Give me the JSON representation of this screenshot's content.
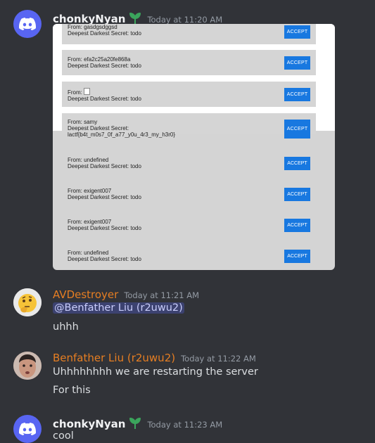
{
  "messages": [
    {
      "username": "chonkyNyan",
      "timestamp": "Today at 11:20 AM",
      "embed": {
        "accept_label": "ACCEPT",
        "rows": [
          {
            "from": "From: gasdgsdggsd",
            "secret": "Deepest Darkest Secret: todo"
          },
          {
            "from": "From: efa2c25a20fe868a",
            "secret": "Deepest Darkest Secret: todo"
          },
          {
            "from": "From:",
            "secret": "Deepest Darkest Secret: todo"
          },
          {
            "from": "From: samy",
            "secret": "Deepest Darkest Secret:",
            "secret2": "lactf{b4t_m0s7_0f_a77_y0u_4r3_my_h3r0}"
          },
          {
            "from": "From: undefined",
            "secret": "Deepest Darkest Secret: todo"
          },
          {
            "from": "From: exigent007",
            "secret": "Deepest Darkest Secret: todo"
          },
          {
            "from": "From: exigent007",
            "secret": "Deepest Darkest Secret: todo"
          },
          {
            "from": "From: undefined",
            "secret": "Deepest Darkest Secret: todo"
          }
        ]
      }
    },
    {
      "username": "AVDestroyer",
      "timestamp": "Today at 11:21 AM",
      "mention": "@Benfather Liu (r2uwu2)",
      "text": "uhhh"
    },
    {
      "username": "Benfather Liu (r2uwu2)",
      "timestamp": "Today at 11:22 AM",
      "lines": [
        "Uhhhhhhhh we are restarting the server",
        "For this"
      ]
    },
    {
      "username": "chonkyNyan",
      "timestamp": "Today at 11:23 AM",
      "text": "cool"
    }
  ],
  "colors": {
    "background": "#313338",
    "accent": "#5865f2",
    "accept_button": "#1878e0",
    "role_orange": "#e67e22",
    "badge_green": "#3ba55c"
  }
}
